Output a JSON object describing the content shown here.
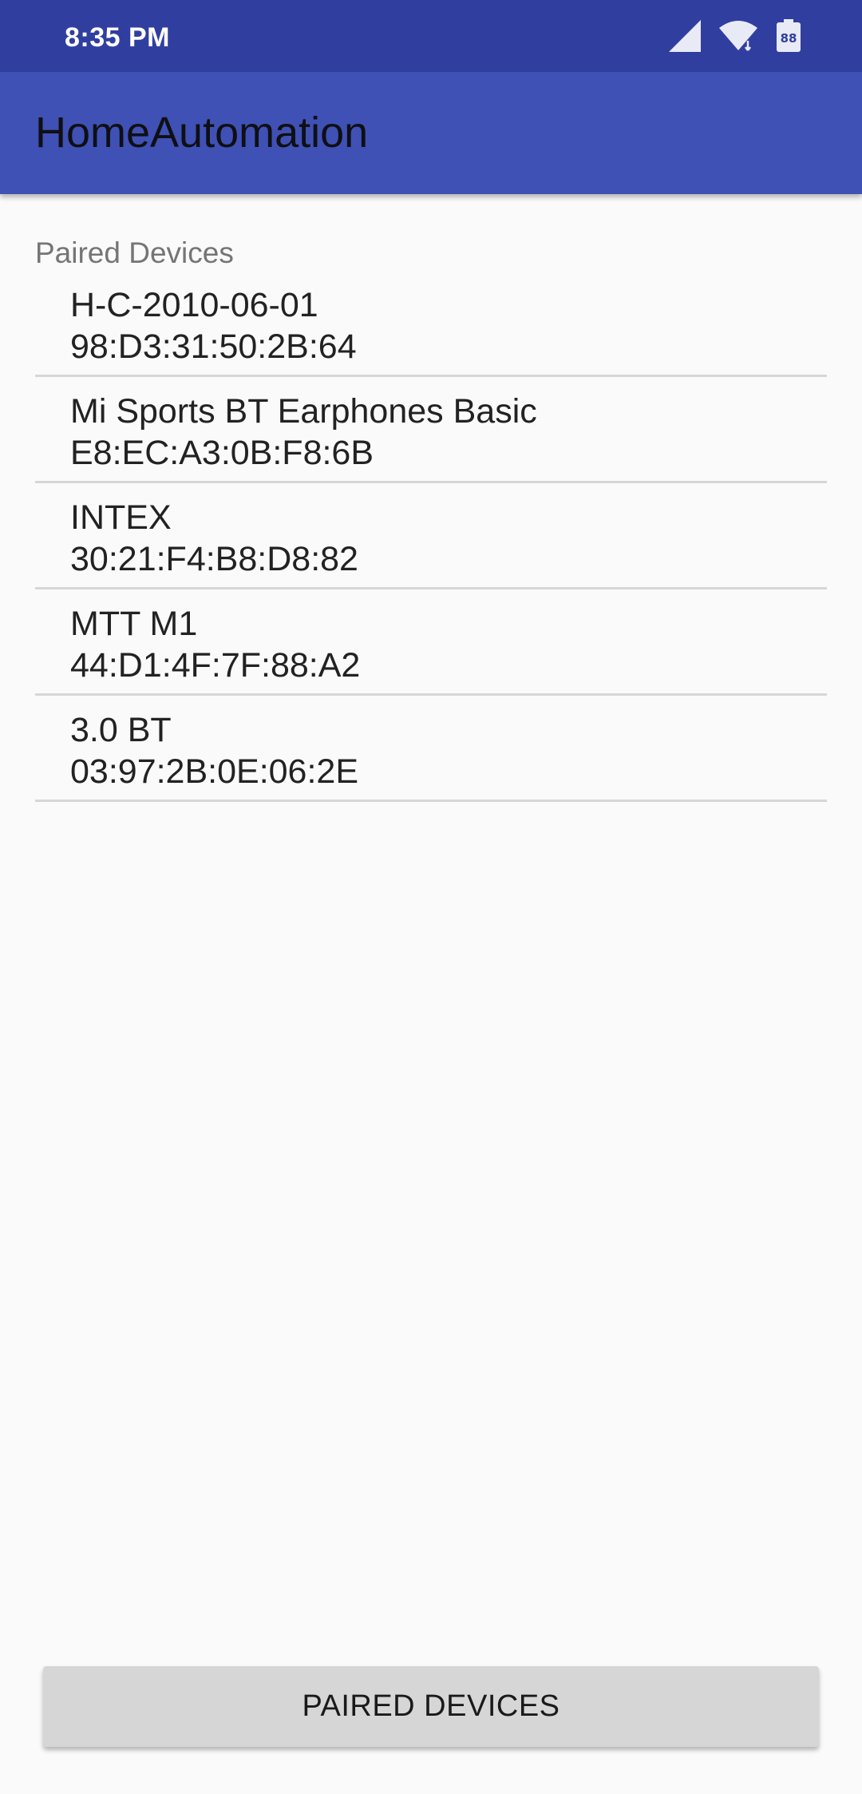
{
  "status_bar": {
    "time": "8:35 PM",
    "battery_level": "88",
    "icons": [
      "signal-icon",
      "wifi-icon",
      "battery-icon"
    ]
  },
  "app_bar": {
    "title": "HomeAutomation"
  },
  "section": {
    "label": "Paired Devices"
  },
  "devices": [
    {
      "name": "H-C-2010-06-01",
      "mac": "98:D3:31:50:2B:64"
    },
    {
      "name": "Mi Sports BT Earphones Basic",
      "mac": "E8:EC:A3:0B:F8:6B"
    },
    {
      "name": "INTEX",
      "mac": "30:21:F4:B8:D8:82"
    },
    {
      "name": "MTT M1",
      "mac": "44:D1:4F:7F:88:A2"
    },
    {
      "name": "3.0 BT",
      "mac": "03:97:2B:0E:06:2E"
    }
  ],
  "button": {
    "label": "PAIRED DEVICES"
  },
  "colors": {
    "status_bar": "#303f9f",
    "app_bar": "#3f51b5",
    "background": "#fafafa",
    "button": "#d6d6d6"
  }
}
